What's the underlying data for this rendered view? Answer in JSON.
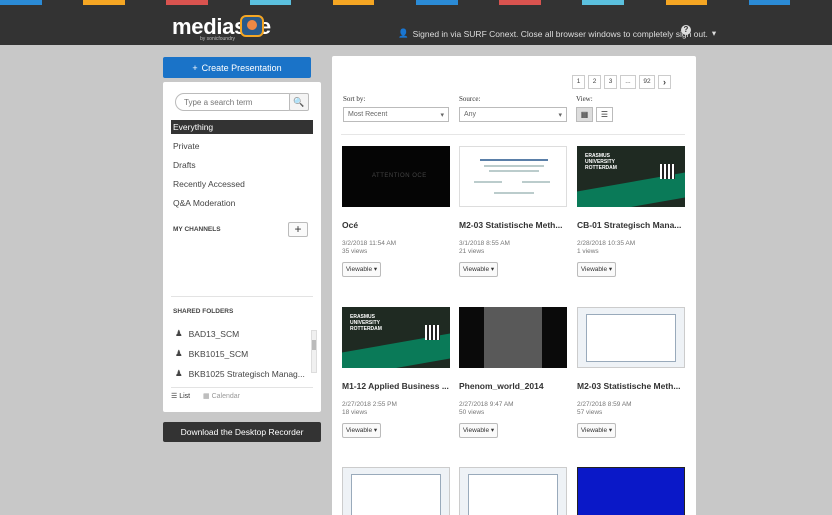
{
  "header": {
    "logo": "mediasite",
    "logo_sub": "by sonicfoundry",
    "signin": "Signed in via SURF Conext. Close all browser windows to completely sign out.",
    "stripe_colors": [
      "#2b8bd6",
      "#333333",
      "#f5a623",
      "#333333",
      "#d9534f",
      "#333333",
      "#5bc0de",
      "#333333",
      "#f5a623",
      "#333333",
      "#2b8bd6",
      "#333333",
      "#d9534f",
      "#333333",
      "#5bc0de",
      "#333333",
      "#f5a623",
      "#333333",
      "#2b8bd6",
      "#333333"
    ]
  },
  "sidebar": {
    "create_label": "Create Presentation",
    "search_placeholder": "Type a search term",
    "nav": [
      "Everything",
      "Private",
      "Drafts",
      "Recently Accessed",
      "Q&A Moderation"
    ],
    "my_channels": "MY CHANNELS",
    "shared_folders": "SHARED FOLDERS",
    "folders": [
      "BAD13_SCM",
      "BKB1015_SCM",
      "BKB1025 Strategisch Manag..."
    ],
    "view_list": "List",
    "view_calendar": "Calendar",
    "download_label": "Download the Desktop Recorder"
  },
  "main": {
    "pager": [
      "1",
      "2",
      "3",
      "...",
      "92"
    ],
    "sort_label": "Sort by:",
    "sort_value": "Most Recent",
    "source_label": "Source:",
    "source_value": "Any",
    "view_label": "View:",
    "viewable_label": "Viewable",
    "items": [
      {
        "title": "Océ",
        "date": "3/2/2018 11:54 AM",
        "views": "35 views",
        "thumb_text": "ATTENTION OCE"
      },
      {
        "title": "M2-03 Statistische Meth...",
        "date": "3/1/2018 8:55 AM",
        "views": "21 views"
      },
      {
        "title": "CB-01 Strategisch Mana...",
        "date": "2/28/2018 10:35 AM",
        "views": "1 views",
        "thumb_text": "ERASMUS UNIVERSITY ROTTERDAM"
      },
      {
        "title": "M1-12 Applied Business ...",
        "date": "2/27/2018 2:55 PM",
        "views": "18 views",
        "thumb_text": "ERASMUS UNIVERSITY ROTTERDAM"
      },
      {
        "title": "Phenom_world_2014",
        "date": "2/27/2018 9:47 AM",
        "views": "50 views"
      },
      {
        "title": "M2-03 Statistische Meth...",
        "date": "2/27/2018 8:59 AM",
        "views": "57 views"
      }
    ]
  }
}
